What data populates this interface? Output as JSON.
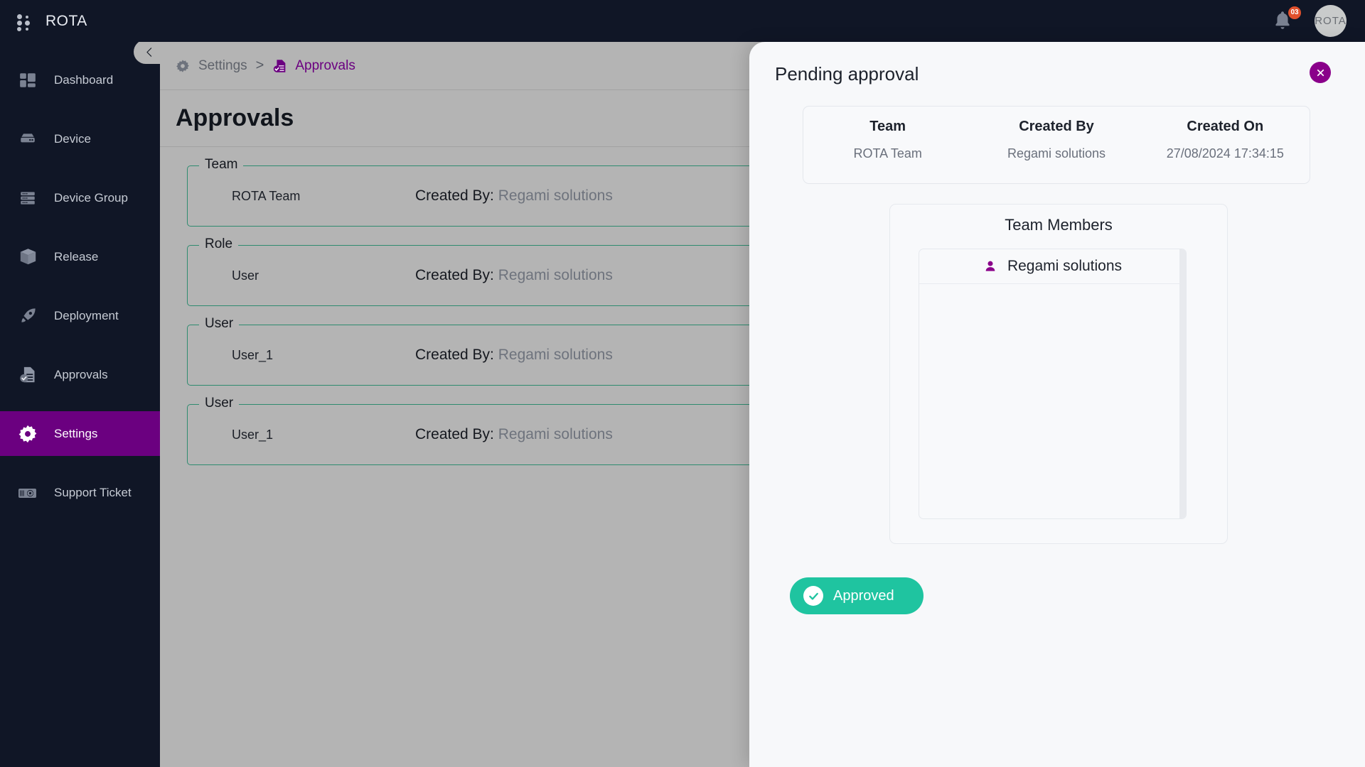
{
  "app": {
    "brand": "ROTA",
    "notification_badge": "03",
    "avatar_label": "ROTA"
  },
  "sidebar": {
    "items": [
      {
        "label": "Dashboard",
        "icon": "dashboard-icon",
        "active": false
      },
      {
        "label": "Device",
        "icon": "device-icon",
        "active": false
      },
      {
        "label": "Device Group",
        "icon": "device-group-icon",
        "active": false
      },
      {
        "label": "Release",
        "icon": "release-box-icon",
        "active": false
      },
      {
        "label": "Deployment",
        "icon": "rocket-icon",
        "active": false
      },
      {
        "label": "Approvals",
        "icon": "approvals-doc-icon",
        "active": false
      },
      {
        "label": "Settings",
        "icon": "gear-icon",
        "active": true
      },
      {
        "label": "Support Ticket",
        "icon": "support-ticket-icon",
        "active": false
      }
    ]
  },
  "breadcrumb": {
    "parent": "Settings",
    "separator": ">",
    "current": "Approvals"
  },
  "page": {
    "title": "Approvals"
  },
  "approval_list": [
    {
      "legend": "Team",
      "name": "ROTA Team",
      "created_by_label": "Created By:",
      "created_by": "Regami solutions"
    },
    {
      "legend": "Role",
      "name": "User",
      "created_by_label": "Created By:",
      "created_by": "Regami solutions"
    },
    {
      "legend": "User",
      "name": "User_1",
      "created_by_label": "Created By:",
      "created_by": "Regami solutions"
    },
    {
      "legend": "User",
      "name": "User_1",
      "created_by_label": "Created By:",
      "created_by": "Regami solutions"
    }
  ],
  "modal": {
    "title": "Pending approval",
    "close_icon": "close-icon",
    "info": {
      "headers": [
        "Team",
        "Created By",
        "Created On"
      ],
      "values": [
        "ROTA Team",
        "Regami solutions",
        "27/08/2024 17:34:15"
      ]
    },
    "members": {
      "title": "Team Members",
      "rows": [
        {
          "name": "Regami solutions",
          "icon": "person-icon"
        }
      ]
    },
    "approve_button": {
      "label": "Approved",
      "icon": "check-circle-icon"
    }
  },
  "colors": {
    "brand_purple": "#6b0080",
    "accent_magenta": "#8a008a",
    "teal_border": "#2e8b6f",
    "approve_green": "#1fc4a0",
    "sidebar_dark": "#101626",
    "content_grey": "#b4b4b4",
    "badge_orange": "#e2512c"
  }
}
